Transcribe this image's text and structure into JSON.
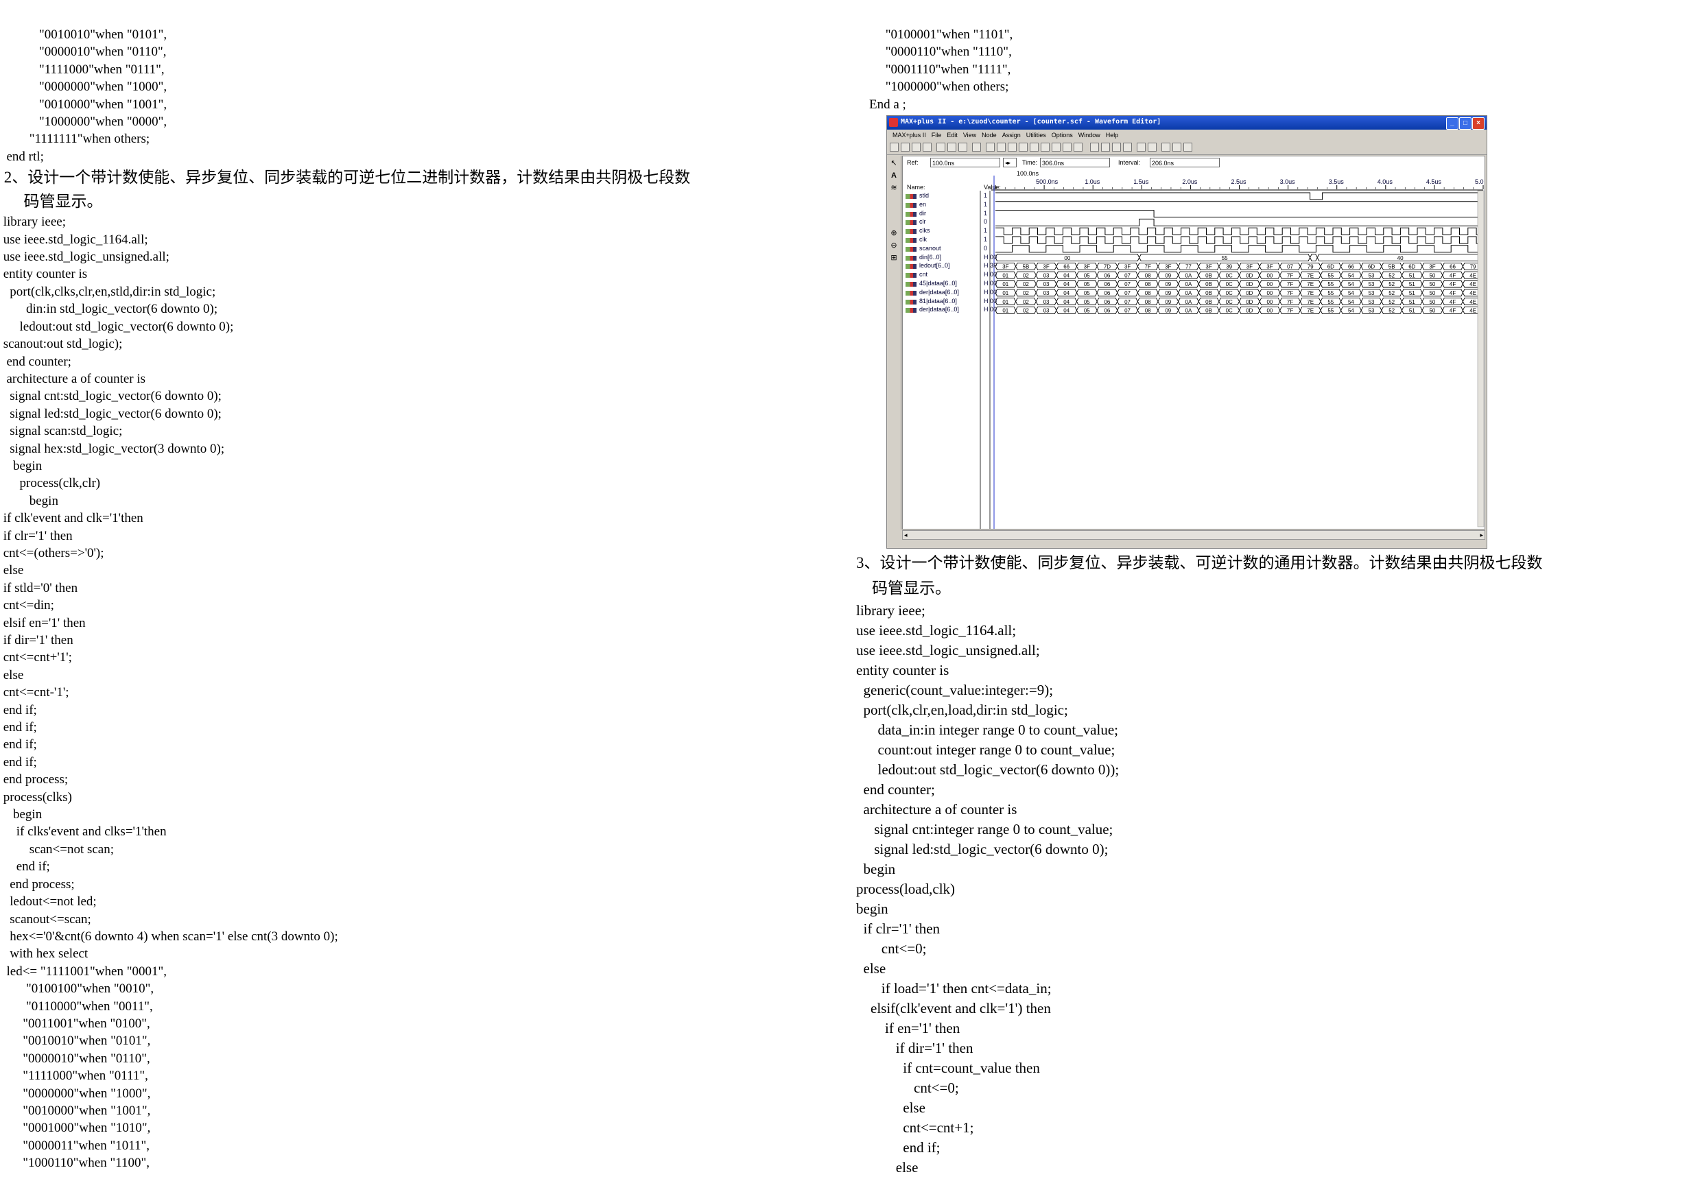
{
  "left": {
    "lines_top": [
      "            \"0010010\"when \"0101\",",
      "            \"0000010\"when \"0110\",",
      "            \"1111000\"when \"0111\",",
      "            \"0000000\"when \"1000\",",
      "            \"0010000\"when \"1001\",",
      "            \"1000000\"when \"0000\",",
      "         \"1111111\"when others;",
      "  end rtl;"
    ],
    "heading": [
      " 2、设计一个带计数使能、异步复位、同步装载的可逆七位二进制计数器，计数结果由共阴极七段数",
      "      码管显示。"
    ],
    "lines_code": [
      " library ieee;",
      " use ieee.std_logic_1164.all;",
      " use ieee.std_logic_unsigned.all;",
      " entity counter is",
      "   port(clk,clks,clr,en,stld,dir:in std_logic;",
      "        din:in std_logic_vector(6 downto 0);",
      "      ledout:out std_logic_vector(6 downto 0);",
      " scanout:out std_logic);",
      "  end counter;",
      "  architecture a of counter is",
      "   signal cnt:std_logic_vector(6 downto 0);",
      "   signal led:std_logic_vector(6 downto 0);",
      "   signal scan:std_logic;",
      "   signal hex:std_logic_vector(3 downto 0);",
      "    begin",
      "      process(clk,clr)",
      "         begin",
      " if clk'event and clk='1'then",
      " if clr='1' then",
      " cnt<=(others=>'0');",
      " else",
      " if stld='0' then",
      " cnt<=din;",
      " elsif en='1' then",
      " if dir='1' then",
      " cnt<=cnt+'1';",
      " else",
      " cnt<=cnt-'1';",
      " end if;",
      " end if;",
      " end if;",
      " end if;",
      " end process;",
      " process(clks)",
      "    begin",
      "     if clks'event and clks='1'then",
      "         scan<=not scan;",
      "     end if;",
      "   end process;",
      "   ledout<=not led;",
      "   scanout<=scan;",
      "   hex<='0'&cnt(6 downto 4) when scan='1' else cnt(3 downto 0);",
      "   with hex select",
      "  led<= \"1111001\"when \"0001\",",
      "        \"0100100\"when \"0010\",",
      "        \"0110000\"when \"0011\",",
      "       \"0011001\"when \"0100\",",
      "       \"0010010\"when \"0101\",",
      "       \"0000010\"when \"0110\",",
      "       \"1111000\"when \"0111\",",
      "       \"0000000\"when \"1000\",",
      "       \"0010000\"when \"1001\",",
      "       \"0001000\"when \"1010\",",
      "       \"0000011\"when \"1011\",",
      "       \"1000110\"when \"1100\","
    ]
  },
  "right_top": {
    "lines": [
      "         \"0100001\"when \"1101\",",
      "         \"0000110\"when \"1110\",",
      "         \"0001110\"when \"1111\",",
      "         \"1000000\"when others;",
      "    End a ;"
    ]
  },
  "waveform": {
    "title": "MAX+plus II - e:\\zuod\\counter - [counter.scf - Waveform Editor]",
    "menu": [
      "MAX+plus II",
      "File",
      "Edit",
      "View",
      "Node",
      "Assign",
      "Utilities",
      "Options",
      "Window",
      "Help"
    ],
    "ref_label": "Ref:",
    "ref_value": "100.0ns",
    "time_label": "Time:",
    "time_value": "306.0ns",
    "interval_label": "Interval:",
    "interval_value": "206.0ns",
    "cursor_label": "100.0ns",
    "name_header": "Name:",
    "value_header": "Value:",
    "time_ticks": [
      "500.0ns",
      "1.0us",
      "1.5us",
      "2.0us",
      "2.5us",
      "3.0us",
      "3.5us",
      "4.0us",
      "4.5us",
      "5.0"
    ],
    "signals": [
      {
        "name": "stld",
        "value": "1",
        "kind": "bit",
        "color": "#000000"
      },
      {
        "name": "en",
        "value": "1",
        "kind": "bit"
      },
      {
        "name": "dir",
        "value": "1",
        "kind": "bit"
      },
      {
        "name": "clr",
        "value": "0",
        "kind": "bit"
      },
      {
        "name": "clks",
        "value": "1",
        "kind": "clock"
      },
      {
        "name": "clk",
        "value": "1",
        "kind": "clock"
      },
      {
        "name": "scanout",
        "value": "0",
        "kind": "clock2"
      },
      {
        "name": "din[6..0]",
        "value": "H 00",
        "kind": "bus",
        "labels": [
          "00",
          "55",
          "40"
        ]
      },
      {
        "name": "ledout[6..0]",
        "value": "H 3F",
        "kind": "busseq",
        "labels": [
          "3F",
          "5B",
          "3F",
          "66",
          "3F",
          "7D",
          "3F",
          "7F",
          "3F",
          "77",
          "3F",
          "39",
          "3F",
          "3F",
          "07",
          "79",
          "6D",
          "66",
          "6D",
          "5B",
          "6D",
          "3F",
          "66",
          "79"
        ]
      },
      {
        "name": "cnt",
        "value": "H 00",
        "kind": "busseq",
        "labels": [
          "01",
          "02",
          "03",
          "04",
          "05",
          "06",
          "07",
          "08",
          "09",
          "0A",
          "0B",
          "0C",
          "0D",
          "00",
          "7F",
          "7E",
          "55",
          "54",
          "53",
          "52",
          "51",
          "50",
          "4F",
          "4E"
        ]
      },
      {
        "name": "45|dataa[6..0]",
        "value": "H 00",
        "kind": "busseq",
        "labels": [
          "01",
          "02",
          "03",
          "04",
          "05",
          "06",
          "07",
          "08",
          "09",
          "0A",
          "0B",
          "0C",
          "0D",
          "00",
          "7F",
          "7E",
          "55",
          "54",
          "53",
          "52",
          "51",
          "50",
          "4F",
          "4E"
        ]
      },
      {
        "name": "der|dataa[6..0]",
        "value": "H 00",
        "kind": "busseq",
        "labels": [
          "01",
          "02",
          "03",
          "04",
          "05",
          "06",
          "07",
          "08",
          "09",
          "0A",
          "0B",
          "0C",
          "0D",
          "00",
          "7F",
          "7E",
          "55",
          "54",
          "53",
          "52",
          "51",
          "50",
          "4F",
          "4E"
        ]
      },
      {
        "name": "81|dataa[6..0]",
        "value": "H 00",
        "kind": "busseq",
        "labels": [
          "01",
          "02",
          "03",
          "04",
          "05",
          "06",
          "07",
          "08",
          "09",
          "0A",
          "0B",
          "0C",
          "0D",
          "00",
          "7F",
          "7E",
          "55",
          "54",
          "53",
          "52",
          "51",
          "50",
          "4F",
          "4E"
        ]
      },
      {
        "name": "der|dataa[6..0]",
        "value": "H 00",
        "kind": "busseq",
        "labels": [
          "01",
          "02",
          "03",
          "04",
          "05",
          "06",
          "07",
          "08",
          "09",
          "0A",
          "0B",
          "0C",
          "0D",
          "00",
          "7F",
          "7E",
          "55",
          "54",
          "53",
          "52",
          "51",
          "50",
          "4F",
          "4E"
        ]
      }
    ]
  },
  "right_bottom": {
    "heading": [
      "3、设计一个带计数使能、同步复位、异步装载、可逆计数的通用计数器。计数结果由共阴极七段数",
      "    码管显示。"
    ],
    "lines": [
      "library ieee;",
      "use ieee.std_logic_1164.all;",
      "use ieee.std_logic_unsigned.all;",
      "entity counter is",
      "  generic(count_value:integer:=9);",
      "  port(clk,clr,en,load,dir:in std_logic;",
      "      data_in:in integer range 0 to count_value;",
      "      count:out integer range 0 to count_value;",
      "      ledout:out std_logic_vector(6 downto 0));",
      "  end counter;",
      "  architecture a of counter is",
      "     signal cnt:integer range 0 to count_value;",
      "     signal led:std_logic_vector(6 downto 0);",
      "  begin",
      "process(load,clk)",
      "begin",
      "  if clr='1' then",
      "       cnt<=0;",
      "  else",
      "       if load='1' then cnt<=data_in;",
      "    elsif(clk'event and clk='1') then",
      "        if en='1' then",
      "           if dir='1' then",
      "             if cnt=count_value then",
      "                cnt<=0;",
      "             else",
      "             cnt<=cnt+1;",
      "             end if;",
      "           else"
    ]
  }
}
